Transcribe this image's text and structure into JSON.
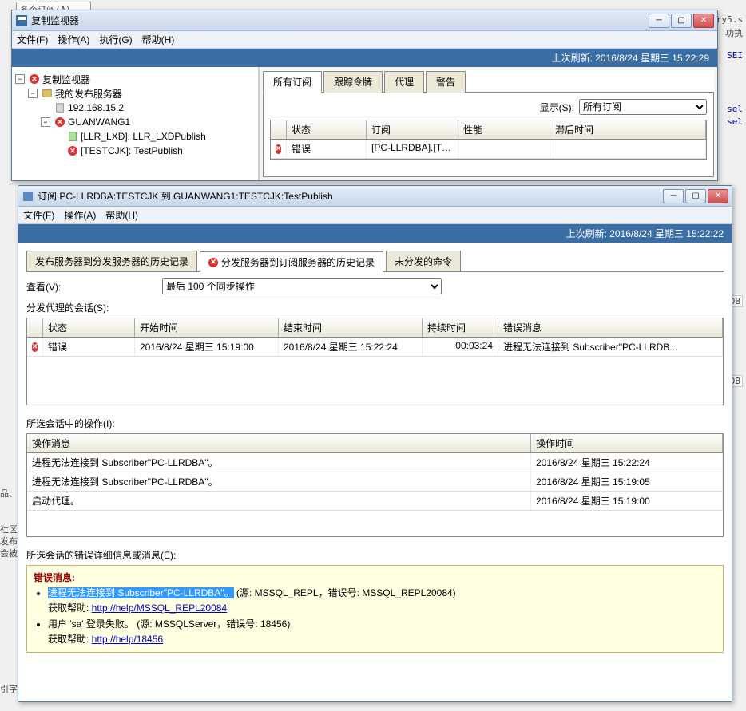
{
  "background": {
    "partial_tab": "多个订阅(A)...",
    "right1": "ry5.s",
    "right2": "功执",
    "right3": "SEI",
    "right_sel": "sel",
    "right_sel2": "sel",
    "right_db": "DB",
    "right_db2": "DB",
    "bottom1": "品、",
    "bottom2": "社区",
    "bottom3": "发布",
    "bottom4": "会被",
    "bottom5": "引字体"
  },
  "monitor": {
    "title": "复制监视器",
    "menu": {
      "file": "文件(F)",
      "action": "操作(A)",
      "exec": "执行(G)",
      "help": "帮助(H)"
    },
    "status": "上次刷新: 2016/8/24 星期三  15:22:29",
    "tree": {
      "root": "复制监视器",
      "pub": "我的发布服务器",
      "ip": "192.168.15.2",
      "srv": "GUANWANG1",
      "item1": "[LLR_LXD]: LLR_LXDPublish",
      "item2": "[TESTCJK]: TestPublish"
    },
    "tabs": {
      "all": "所有订阅",
      "tokens": "跟踪令牌",
      "agents": "代理",
      "warn": "警告"
    },
    "show_label": "显示(S):",
    "show_value": "所有订阅",
    "grid": {
      "h_status": "状态",
      "h_sub": "订阅",
      "h_perf": "性能",
      "h_latency": "滞后时间",
      "r1_status": "错误",
      "r1_sub": "[PC-LLRDBA].[TE..."
    }
  },
  "detail": {
    "title": "订阅 PC-LLRDBA:TESTCJK 到 GUANWANG1:TESTCJK:TestPublish",
    "menu": {
      "file": "文件(F)",
      "action": "操作(A)",
      "help": "帮助(H)"
    },
    "status": "上次刷新: 2016/8/24 星期三  15:22:22",
    "subtabs": {
      "t1": "发布服务器到分发服务器的历史记录",
      "t2": "分发服务器到订阅服务器的历史记录",
      "t3": "未分发的命令"
    },
    "view_label": "查看(V):",
    "view_value": "最后 100 个同步操作",
    "sessions_label": "分发代理的会话(S):",
    "grid": {
      "h_status": "状态",
      "h_start": "开始时间",
      "h_end": "结束时间",
      "h_dur": "持续时间",
      "h_msg": "错误消息",
      "r1_status": "错误",
      "r1_start": "2016/8/24 星期三 15:19:00",
      "r1_end": "2016/8/24 星期三 15:22:24",
      "r1_dur": "00:03:24",
      "r1_msg": "进程无法连接到 Subscriber\"PC-LLRDB..."
    },
    "actions_label": "所选会话中的操作(I):",
    "actions": {
      "h_msg": "操作消息",
      "h_time": "操作时间",
      "rows": [
        {
          "msg": "进程无法连接到 Subscriber\"PC-LLRDBA\"。",
          "time": "2016/8/24 星期三 15:22:24"
        },
        {
          "msg": "进程无法连接到 Subscriber\"PC-LLRDBA\"。",
          "time": "2016/8/24 星期三 15:19:05"
        },
        {
          "msg": "启动代理。",
          "time": "2016/8/24 星期三 15:19:00"
        }
      ]
    },
    "errdetail_label": "所选会话的错误详细信息或消息(E):",
    "err": {
      "heading": "错误消息:",
      "line1_hl": "进程无法连接到 Subscriber\"PC-LLRDBA\"。",
      "line1_rest": " (源: MSSQL_REPL，错误号: MSSQL_REPL20084)",
      "help_label": "获取帮助: ",
      "help_link1": "http://help/MSSQL_REPL20084",
      "line2": "用户 'sa' 登录失败。 (源: MSSQLServer，错误号: 18456)",
      "help_link2": "http://help/18456"
    }
  }
}
